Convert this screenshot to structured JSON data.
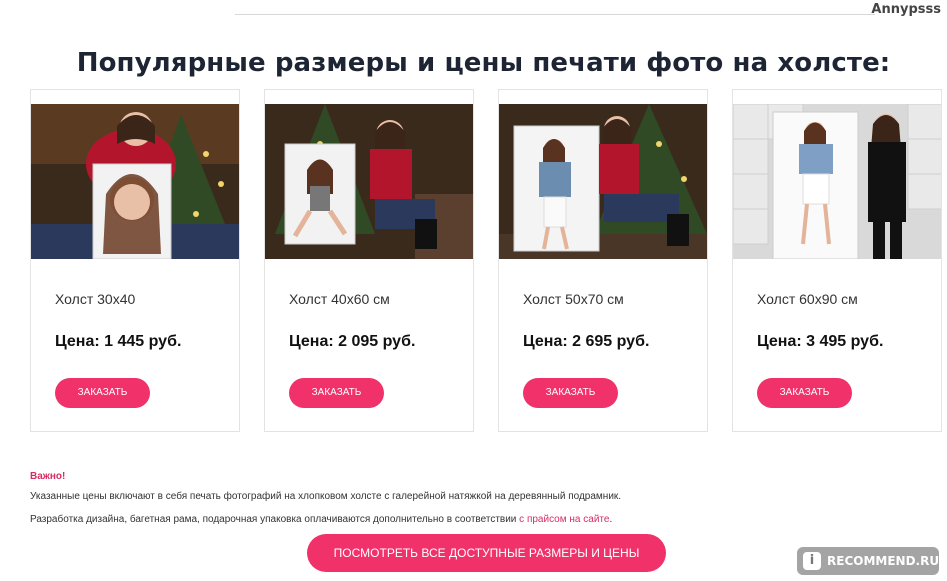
{
  "watermark_user": "Annypsss",
  "heading": "Популярные размеры и цены печати фото на холсте:",
  "cards": [
    {
      "size": "Холст 30х40",
      "price": "Цена: 1 445 руб.",
      "button": "ЗАКАЗАТЬ"
    },
    {
      "size": "Холст 40х60 см",
      "price": "Цена: 2 095 руб.",
      "button": "ЗАКАЗАТЬ"
    },
    {
      "size": "Холст 50х70 см",
      "price": "Цена: 2 695 руб.",
      "button": "ЗАКАЗАТЬ"
    },
    {
      "size": "Холст 60х90 см",
      "price": "Цена: 3 495 руб.",
      "button": "ЗАКАЗАТЬ"
    }
  ],
  "notes": {
    "important": "Важно!",
    "line1": "Указанные цены включают в себя печать фотографий на хлопковом холсте с галерейной натяжкой на деревянный подрамник.",
    "line2": "Разработка дизайна, багетная рама, подарочная упаковка оплачиваются дополнительно в соответствии ",
    "link": "с прайсом на сайте",
    "line2_end": "."
  },
  "all_sizes_button": "ПОСМОТРЕТЬ ВСЕ ДОСТУПНЫЕ РАЗМЕРЫ И ЦЕНЫ",
  "badge": {
    "icon": "i",
    "text": "RECOMMEND.RU"
  },
  "colors": {
    "accent": "#f0316a",
    "heading": "#1d2433",
    "link": "#d62d62"
  }
}
